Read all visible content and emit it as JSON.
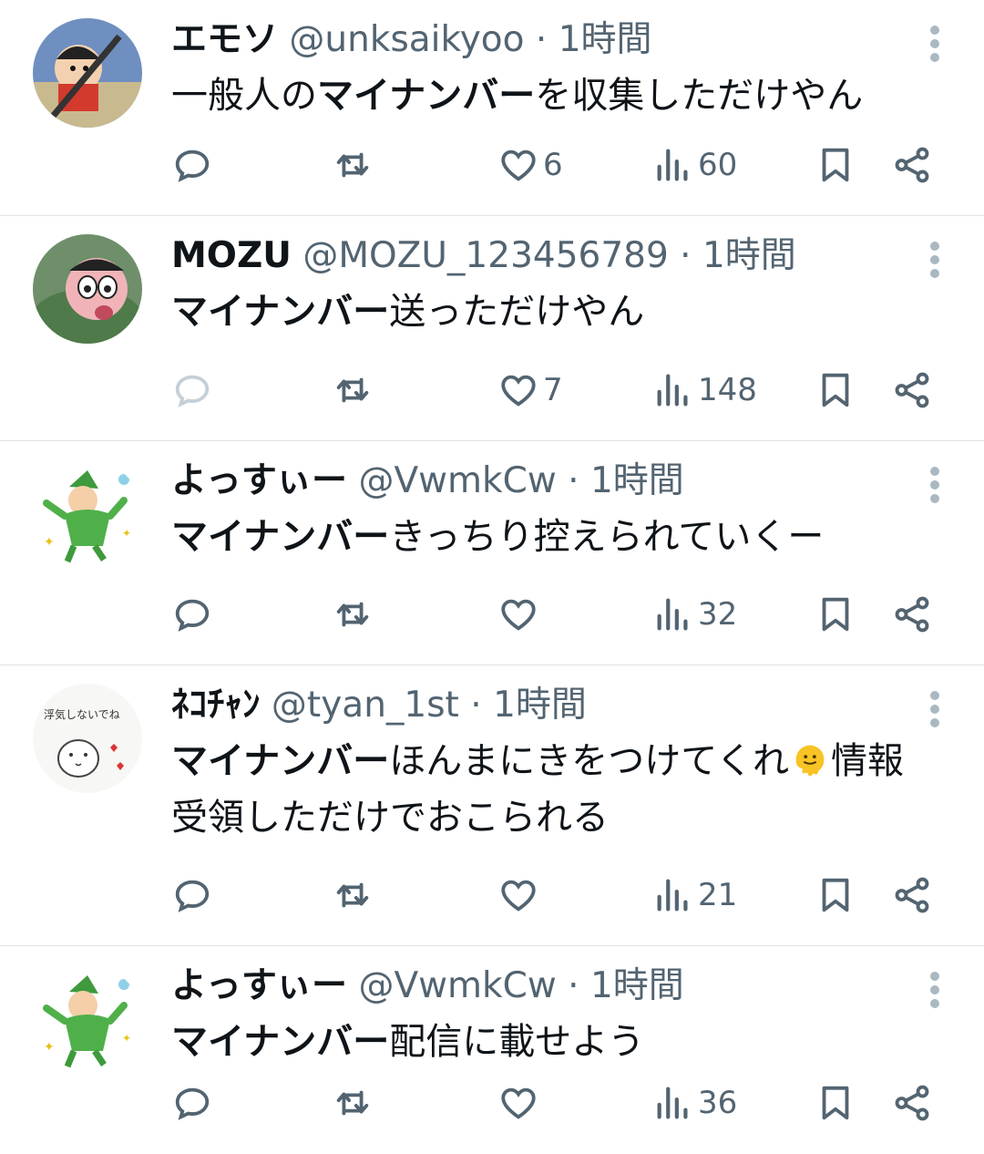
{
  "tweets": [
    {
      "name": "エモソ",
      "handle": "@unksaikyoo",
      "time": "1時間",
      "text_parts": [
        {
          "text": "一般人の",
          "bold": false
        },
        {
          "text": "マイナンバー",
          "bold": true
        },
        {
          "text": "を収集しただけやん",
          "bold": false
        }
      ],
      "likes": "6",
      "views": "60",
      "reply_dim": false
    },
    {
      "name": "MOZU",
      "handle": "@MOZU_123456789",
      "time": "1時間",
      "text_parts": [
        {
          "text": "マイナンバー",
          "bold": true
        },
        {
          "text": "送っただけやん",
          "bold": false
        }
      ],
      "likes": "7",
      "views": "148",
      "reply_dim": true
    },
    {
      "name": "よっすぃー",
      "handle": "@VwmkCw",
      "time": "1時間",
      "text_parts": [
        {
          "text": "マイナンバー",
          "bold": true
        },
        {
          "text": "きっちり控えられていくー",
          "bold": false
        }
      ],
      "likes": "",
      "views": "32",
      "reply_dim": false
    },
    {
      "name": "ﾈｺﾁｬﾝ",
      "handle": "@tyan_1st",
      "time": "1時間",
      "text_parts": [
        {
          "text": "マイナンバー",
          "bold": true
        },
        {
          "text": "ほんまにきをつけてくれ",
          "bold": false
        },
        {
          "emoji": "melting-face"
        },
        {
          "text": "情報受領しただけでおこられる",
          "bold": false
        }
      ],
      "likes": "",
      "views": "21",
      "reply_dim": false
    },
    {
      "name": "よっすぃー",
      "handle": "@VwmkCw",
      "time": "1時間",
      "text_parts": [
        {
          "text": "マイナンバー",
          "bold": true
        },
        {
          "text": "配信に載せよう",
          "bold": false
        }
      ],
      "likes": "",
      "views": "36",
      "reply_dim": false
    }
  ],
  "separator": "·",
  "colors": {
    "text": "#0f1419",
    "secondary": "#536471",
    "divider": "#dfe3e6",
    "reply_dim": "#c5cfd6"
  },
  "icons": [
    "reply-icon",
    "retweet-icon",
    "heart-icon",
    "views-icon",
    "bookmark-icon",
    "share-icon",
    "more-icon"
  ]
}
